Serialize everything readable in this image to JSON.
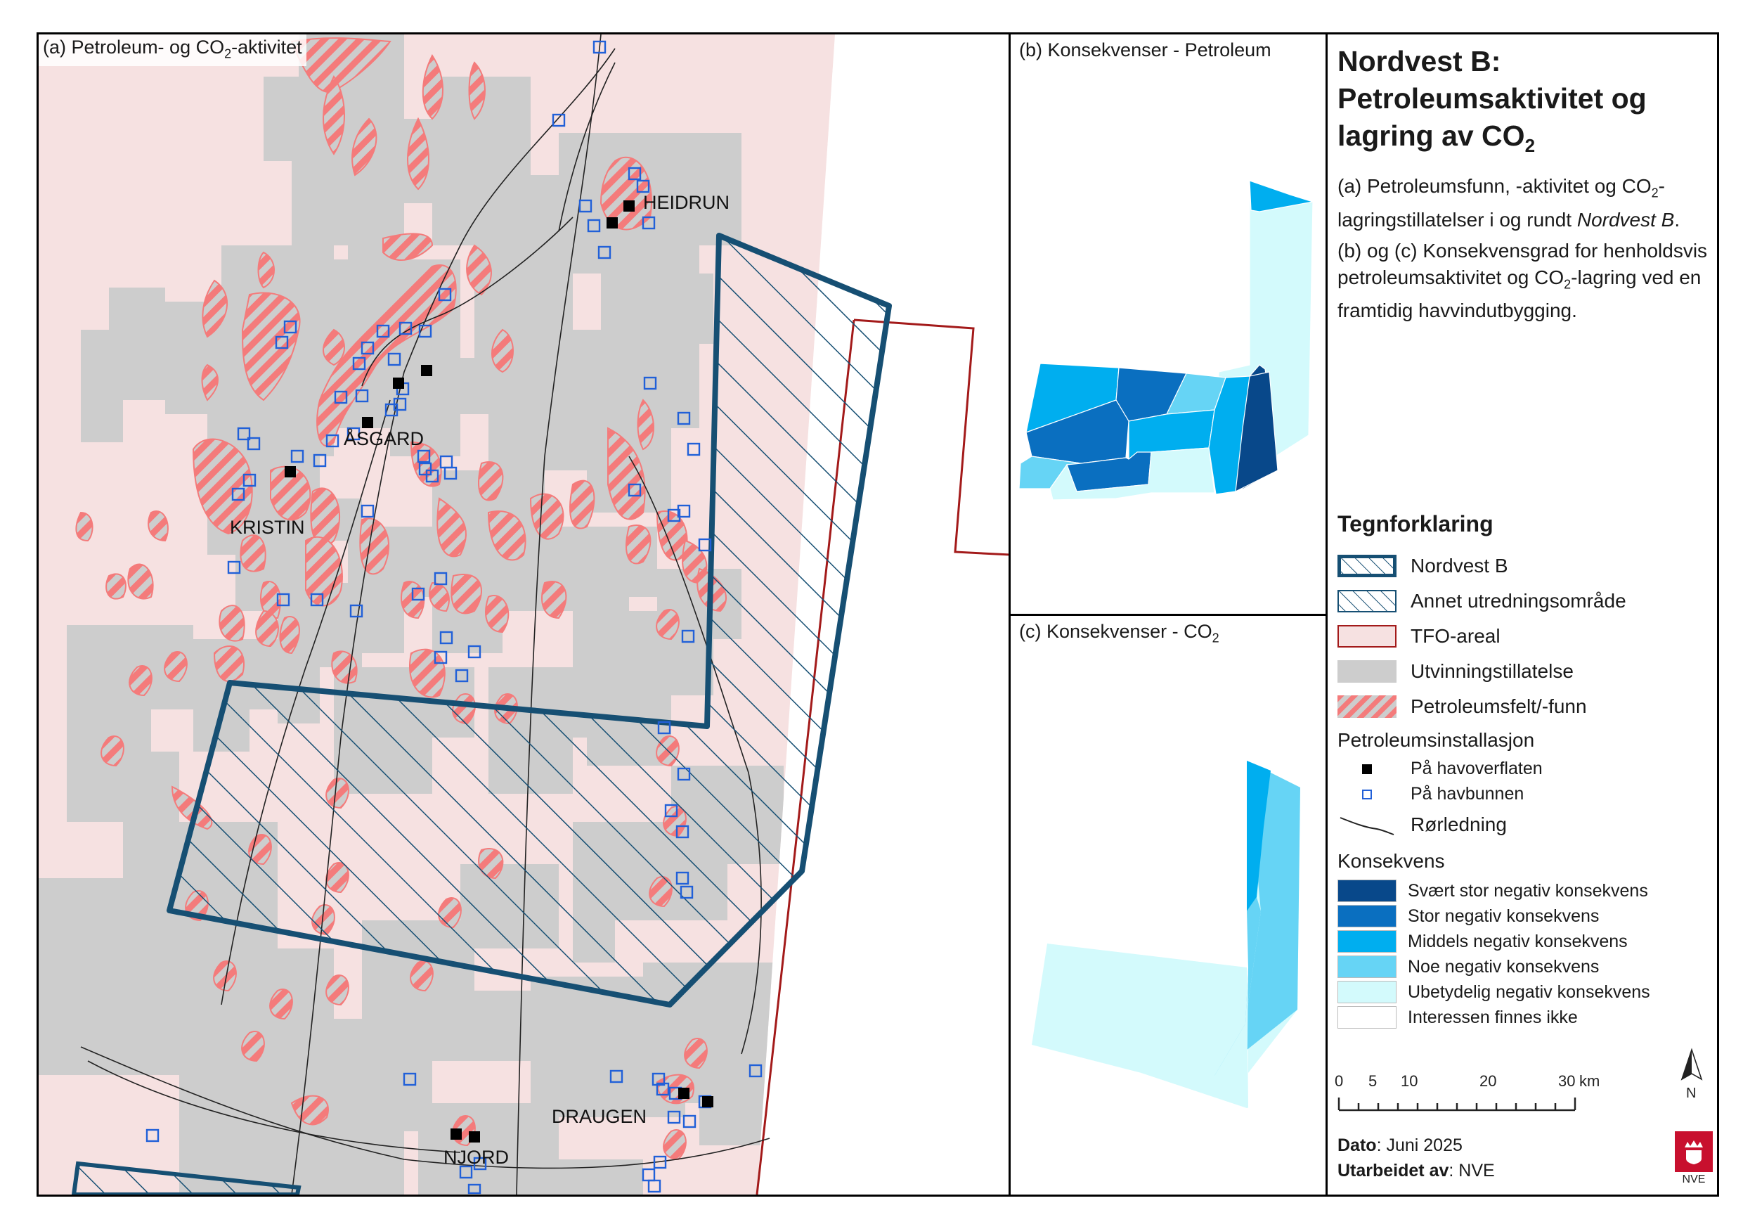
{
  "panel_a": {
    "title_pre": "(a) Petroleum- og CO",
    "title_sub": "2",
    "title_post": "-aktivitet",
    "labels": {
      "heidrun": "HEIDRUN",
      "asgard": "ÅSGARD",
      "kristin": "KRISTIN",
      "draugen": "DRAUGEN",
      "njord": "NJORD"
    }
  },
  "panel_b": {
    "title": "(b) Konsekvenser - Petroleum"
  },
  "panel_c": {
    "title_pre": "(c) Konsekvenser - CO",
    "title_sub": "2"
  },
  "legend": {
    "title_line1": "Nordvest B:",
    "title_line2": "Petroleumsaktivitet og",
    "title_line3_pre": "lagring av CO",
    "title_line3_sub": "2",
    "desc_a_1": "(a) Petroleumsfunn, -aktivitet og CO",
    "desc_a_sub": "2",
    "desc_a_2": "-lagringstillatelser i og rundt ",
    "desc_a_italic": "Nordvest B",
    "desc_a_end": ".",
    "desc_bc": "(b) og (c) Konsekvensgrad for henholdsvis petroleumsaktivitet og CO",
    "desc_bc_sub": "2",
    "desc_bc_end": "-lagring ved en framtidig havvindutbygging.",
    "heading": "Tegnforklaring",
    "items": {
      "nordvest_b": "Nordvest B",
      "annet": "Annet utredningsområde",
      "tfo": "TFO-areal",
      "utvinning": "Utvinningstillatelse",
      "petroleumsfelt": "Petroleumsfelt/-funn"
    },
    "installasjon_heading": "Petroleumsinstallasjon",
    "havoverflaten": "På havoverflaten",
    "havbunnen": "På havbunnen",
    "rorledning": "Rørledning",
    "konsekvens_heading": "Konsekvens",
    "konsekvens": [
      {
        "label": "Svært stor negativ konsekvens",
        "color": "#08488a"
      },
      {
        "label": "Stor negativ konsekvens",
        "color": "#0a6fc0"
      },
      {
        "label": "Middels negativ konsekvens",
        "color": "#00aeef"
      },
      {
        "label": "Noe negativ konsekvens",
        "color": "#66d4f5"
      },
      {
        "label": "Ubetydelig negativ konsekvens",
        "color": "#d3fafc"
      },
      {
        "label": "Interessen finnes ikke",
        "color": "#ffffff"
      }
    ],
    "scale_ticks": [
      "0",
      "5",
      "10",
      "20",
      "30"
    ],
    "scale_unit": "km",
    "north": "N",
    "dato_label": "Dato",
    "dato_value": ": Juni 2025",
    "utarbeidet_label": "Utarbeidet av",
    "utarbeidet_value": ": NVE",
    "logo_text": "NVE"
  },
  "colors": {
    "nordvest": "#164f73",
    "tfo_fill": "#f6e1e1",
    "tfo_border": "#a31a1a",
    "license": "#cdcdcd",
    "petro": "#f47b7b",
    "subsea": "#2160d8"
  }
}
